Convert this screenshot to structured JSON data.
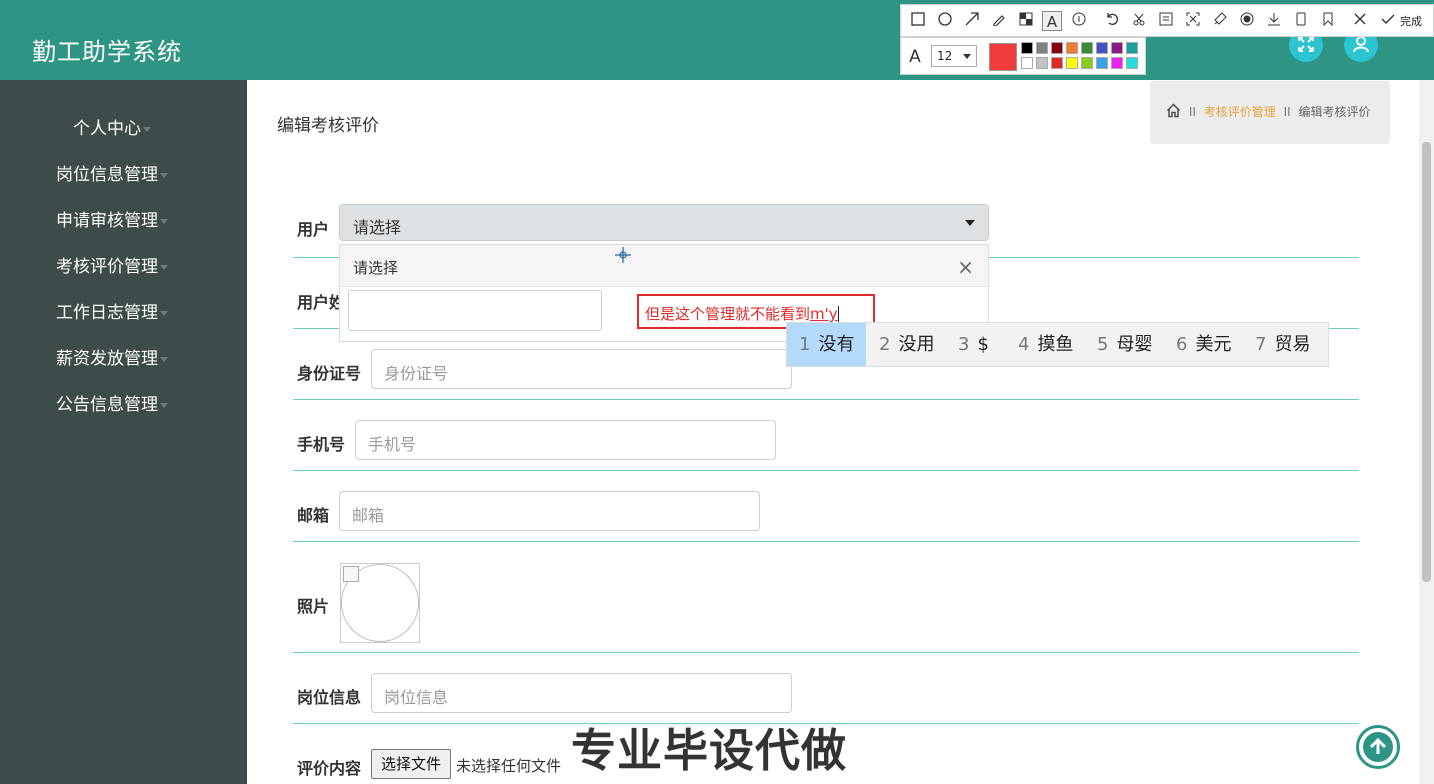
{
  "app": {
    "title": "勤工助学系统"
  },
  "sidebar": {
    "items": [
      {
        "label": "个人中心"
      },
      {
        "label": "岗位信息管理"
      },
      {
        "label": "申请审核管理"
      },
      {
        "label": "考核评价管理"
      },
      {
        "label": "工作日志管理"
      },
      {
        "label": "薪资发放管理"
      },
      {
        "label": "公告信息管理"
      }
    ]
  },
  "page": {
    "title": "编辑考核评价"
  },
  "breadcrumb": {
    "section": "考核评价管理",
    "current": "编辑考核评价"
  },
  "form": {
    "user_label": "用户",
    "user_select_value": "请选择",
    "dropdown_header": "请选择",
    "user_name_label": "用户姓",
    "id_label": "身份证号",
    "id_placeholder": "身份证号",
    "phone_label": "手机号",
    "phone_placeholder": "手机号",
    "email_label": "邮箱",
    "email_placeholder": "邮箱",
    "photo_label": "照片",
    "post_label": "岗位信息",
    "post_placeholder": "岗位信息",
    "eval_label": "评价内容",
    "file_button": "选择文件",
    "file_status": "未选择任何文件"
  },
  "annotation": {
    "text": "但是这个管理就不能看到",
    "composing": "m'y"
  },
  "ime": {
    "candidates": [
      {
        "num": "1",
        "text": "没有"
      },
      {
        "num": "2",
        "text": "没用"
      },
      {
        "num": "3",
        "text": "$"
      },
      {
        "num": "4",
        "text": "摸鱼"
      },
      {
        "num": "5",
        "text": "母婴"
      },
      {
        "num": "6",
        "text": "美元"
      },
      {
        "num": "7",
        "text": "贸易"
      }
    ]
  },
  "screenshot_tool": {
    "done_label": "完成",
    "font_size": "12",
    "current_color": "#f23c3c",
    "palette": [
      "#000000",
      "#7f7f7f",
      "#880015",
      "#ed7d31",
      "#3a8a3a",
      "#4054c8",
      "#8b1a8b",
      "#17a0a0",
      "#ffffff",
      "#c3c3c3",
      "#e02a2a",
      "#ffff00",
      "#88cc22",
      "#3a9ee8",
      "#ee22ee",
      "#22dddd"
    ]
  },
  "watermark": {
    "text": "专业毕设代做"
  },
  "colors": {
    "header": "#2e9585",
    "sidebar": "#3d4b4b",
    "accent": "#e6a43c",
    "divider": "#6fcdc2"
  }
}
